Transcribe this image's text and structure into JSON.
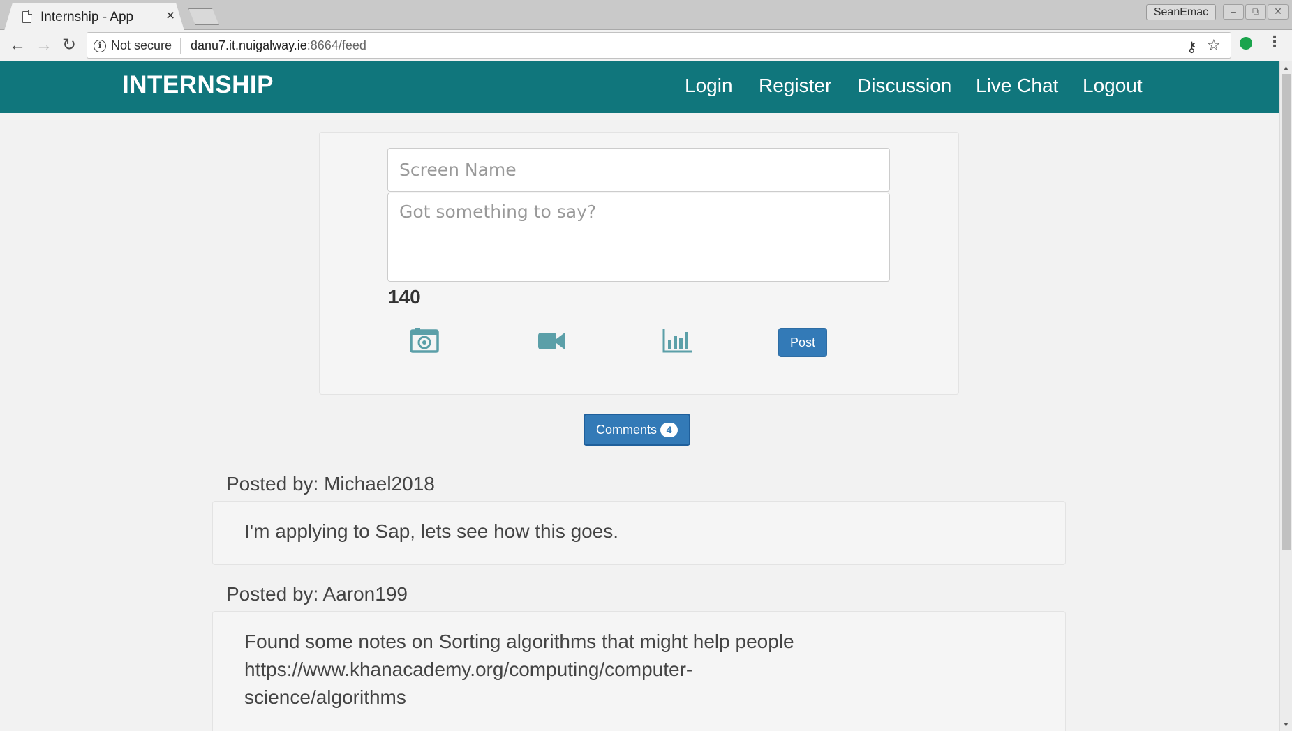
{
  "browser": {
    "tab_title": "Internship - App",
    "tab_close": "×",
    "profile_name": "SeanEmac",
    "security_label": "Not secure",
    "url_host": "danu7.it.nuigalway.ie",
    "url_rest": ":8664/feed",
    "window_buttons": {
      "minimize": "–",
      "restore": "⧉",
      "close": "✕"
    },
    "nav": {
      "back": "←",
      "forward": "→",
      "reload": "↻"
    },
    "icons": {
      "info": "i",
      "key": "⚷",
      "star": "☆",
      "menu": "⋮"
    }
  },
  "navbar": {
    "brand": "INTERNSHIP",
    "links": [
      "Login",
      "Register",
      "Discussion",
      "Live Chat",
      "Logout"
    ],
    "color": "#10767c"
  },
  "compose": {
    "screen_name_placeholder": "Screen Name",
    "message_placeholder": "Got something to say?",
    "char_count": "140",
    "post_label": "Post",
    "icons": [
      "camera-icon",
      "video-camera-icon",
      "bar-chart-icon"
    ],
    "icon_color": "#5b9fa8"
  },
  "comments_button": {
    "label": "Comments",
    "count": "4",
    "color": "#337ab7"
  },
  "posts": [
    {
      "author_line": "Posted by: Michael2018",
      "text": "I'm applying to Sap, lets see how this goes."
    },
    {
      "author_line": "Posted by: Aaron199",
      "text": "Found some notes on Sorting algorithms that might help people https://www.khanacademy.org/computing/computer-science/algorithms"
    }
  ]
}
